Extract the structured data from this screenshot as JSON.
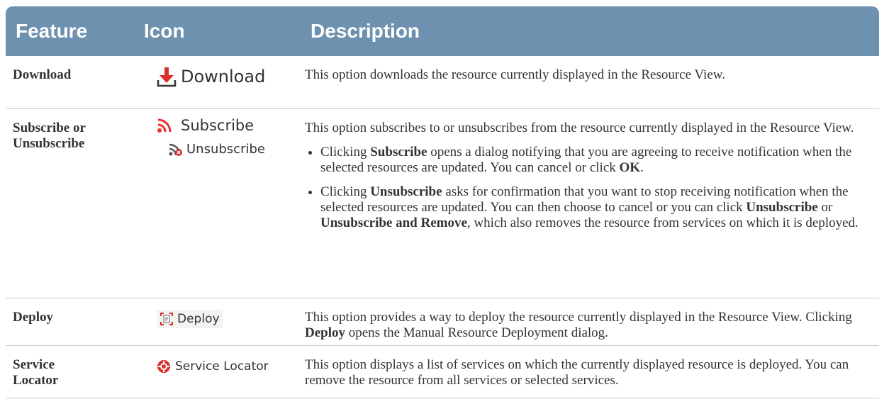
{
  "headers": {
    "feature": "Feature",
    "icon": "Icon",
    "description": "Description"
  },
  "rows": [
    {
      "feature": "Download",
      "icon_label": "Download",
      "icon_name": "download-icon",
      "description": "This option downloads the resource currently displayed in the Resource View."
    },
    {
      "feature_line1": "Subscribe or",
      "feature_line2": "Unsubscribe",
      "icon_label": "Subscribe",
      "icon_name": "rss-icon",
      "icon_label2": "Unsubscribe",
      "icon_name2": "rss-unsubscribe-icon",
      "description": "This option subscribes to or unsubscribes from the resource currently displayed in the Resource View.",
      "bullet1": {
        "pre": "Clicking ",
        "b1": "Subscribe",
        "mid": " opens a dialog notifying that you are agreeing to receive notification when the selected resources are updated. You can cancel or click ",
        "b2": "OK",
        "post": "."
      },
      "bullet2": {
        "pre": "Clicking ",
        "b1": "Unsubscribe",
        "mid": " asks for confirmation that you want to stop receiving notification when the selected resources are updated. You can then choose to cancel or you can click ",
        "b2": "Unsubscribe",
        "mid2": " or ",
        "b3": "Unsubscribe and Remove",
        "post": ", which also removes the resource from services on which it is deployed."
      }
    },
    {
      "feature": "Deploy",
      "icon_label": "Deploy",
      "icon_name": "deploy-icon",
      "description_pre": "This option provides a way to deploy the resource currently displayed in the Resource View. Clicking ",
      "description_bold": "Deploy",
      "description_post": " opens the Manual Resource Deployment dialog."
    },
    {
      "feature_line1": "Service",
      "feature_line2": "Locator",
      "icon_label": "Service Locator",
      "icon_name": "locator-icon",
      "description": "This option displays a list of services on which the currently displayed resource is deployed. You can remove the resource from all services or selected services."
    }
  ],
  "colors": {
    "header_bg": "#6d91ae",
    "header_text": "#ffffff",
    "download_red": "#d9302c",
    "rss_red": "#e8312f"
  }
}
